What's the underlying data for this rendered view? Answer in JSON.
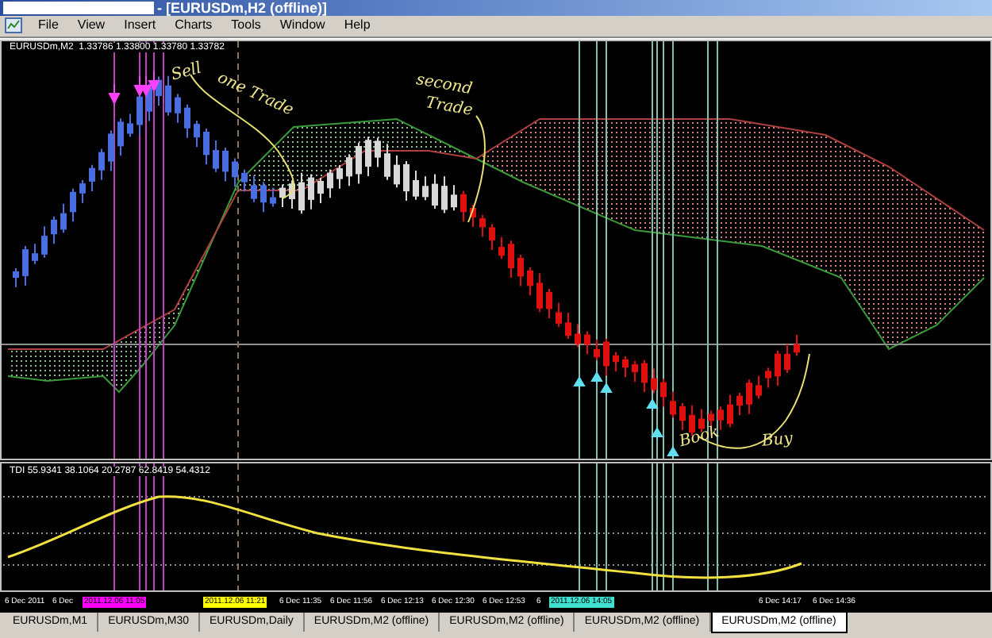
{
  "window": {
    "title": "- [EURUSDm,H2 (offline)]"
  },
  "menu": [
    "File",
    "View",
    "Insert",
    "Charts",
    "Tools",
    "Window",
    "Help"
  ],
  "chart": {
    "header": "EURUSDm,M2  1.33786 1.33800 1.33780 1.33782",
    "annotations": [
      {
        "text": "Sell"
      },
      {
        "text": "one Trade"
      },
      {
        "text": "second"
      },
      {
        "text": "Trade"
      },
      {
        "text": "Book"
      },
      {
        "text": "Buy"
      }
    ]
  },
  "indicator": {
    "label": "TDI 55.9341 38.1064 20.2787 62.8419 54.4312"
  },
  "time_axis": [
    {
      "text": "6 Dec 2011"
    },
    {
      "text": "6 Dec"
    },
    {
      "text": "2011.12.06 11:05",
      "color": "#ff00ff"
    },
    {
      "text": "2011.12.06 11:21",
      "color": "#ffff00"
    },
    {
      "text": "6 Dec 11:35"
    },
    {
      "text": "6 Dec 11:56"
    },
    {
      "text": "6 Dec 12:13"
    },
    {
      "text": "6 Dec 12:30"
    },
    {
      "text": "6 Dec 12:53"
    },
    {
      "text": "6"
    },
    {
      "text": "2011.12.06 14:05",
      "color": "#40e0d0"
    },
    {
      "text": "6 Dec 14:17"
    },
    {
      "text": "6 Dec 14:36"
    }
  ],
  "tabs": [
    {
      "label": "EURUSDm,M1",
      "selected": false
    },
    {
      "label": "EURUSDm,M30",
      "selected": false
    },
    {
      "label": "EURUSDm,Daily",
      "selected": false
    },
    {
      "label": "EURUSDm,M2 (offline)",
      "selected": false
    },
    {
      "label": "EURUSDm,M2 (offline)",
      "selected": false
    },
    {
      "label": "EURUSDm,M2 (offline)",
      "selected": false
    },
    {
      "label": "EURUSDm,M2 (offline)",
      "selected": true
    }
  ]
}
